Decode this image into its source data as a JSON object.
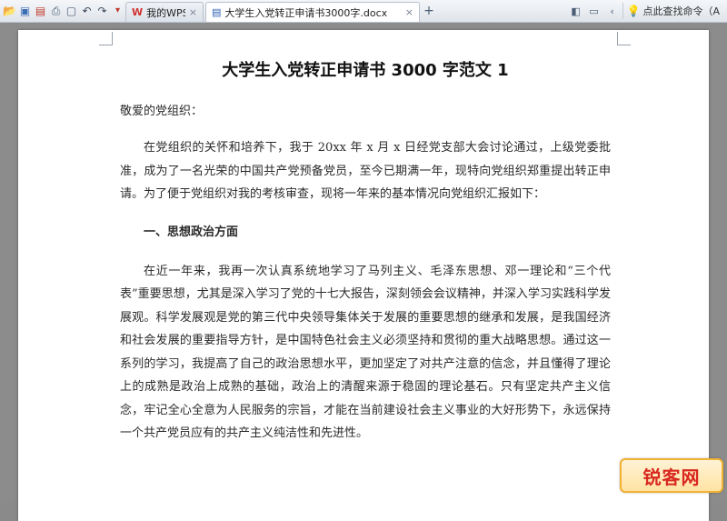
{
  "toolbar": {
    "icons": [
      "open-icon",
      "save-icon",
      "export-pdf-icon",
      "print-icon",
      "print-preview-icon",
      "undo-icon",
      "redo-icon",
      "more-icon"
    ]
  },
  "tabs": [
    {
      "label": "我的WPS",
      "icon": "W",
      "close": "×"
    },
    {
      "label": "大学生入党转正申请书3000字.docx",
      "icon": "▤",
      "close": "×"
    }
  ],
  "new_tab": "+",
  "right_toolbar": {
    "search_command_label": "点此查找命令（A"
  },
  "document": {
    "title": "大学生入党转正申请书 3000 字范文 1",
    "greeting": "敬爱的党组织：",
    "paragraph1": "在党组织的关怀和培养下，我于 20xx 年 x 月 x 日经党支部大会讨论通过，上级党委批准，成为了一名光荣的中国共产党预备党员，至今已期满一年，现特向党组织郑重提出转正申请。为了便于党组织对我的考核审查，现将一年来的基本情况向党组织汇报如下：",
    "section_heading": "一、思想政治方面",
    "paragraph2": "在近一年来，我再一次认真系统地学习了马列主义、毛泽东思想、邓一理论和“三个代表”重要思想，尤其是深入学习了党的十七大报告，深刻领会会议精神，并深入学习实践科学发展观。科学发展观是党的第三代中央领导集体关于发展的重要思想的继承和发展，是我国经济和社会发展的重要指导方针，是中国特色社会主义必须坚持和贯彻的重大战略思想。通过这一系列的学习，我提高了自己的政治思想水平，更加坚定了对共产注意的信念，并且懂得了理论上的成熟是政治上成熟的基础，政治上的清醒来源于稳固的理论基石。只有坚定共产主义信念，牢记全心全意为人民服务的宗旨，才能在当前建设社会主义事业的大好形势下，永远保持一个共产党员应有的共产主义纯洁性和先进性。"
  },
  "watermark": "锐客网",
  "colors": {
    "brand_red": "#d0312d",
    "watermark_red": "#d8281f",
    "page_background": "#ffffff",
    "workspace_gray": "#8c8c8c"
  }
}
